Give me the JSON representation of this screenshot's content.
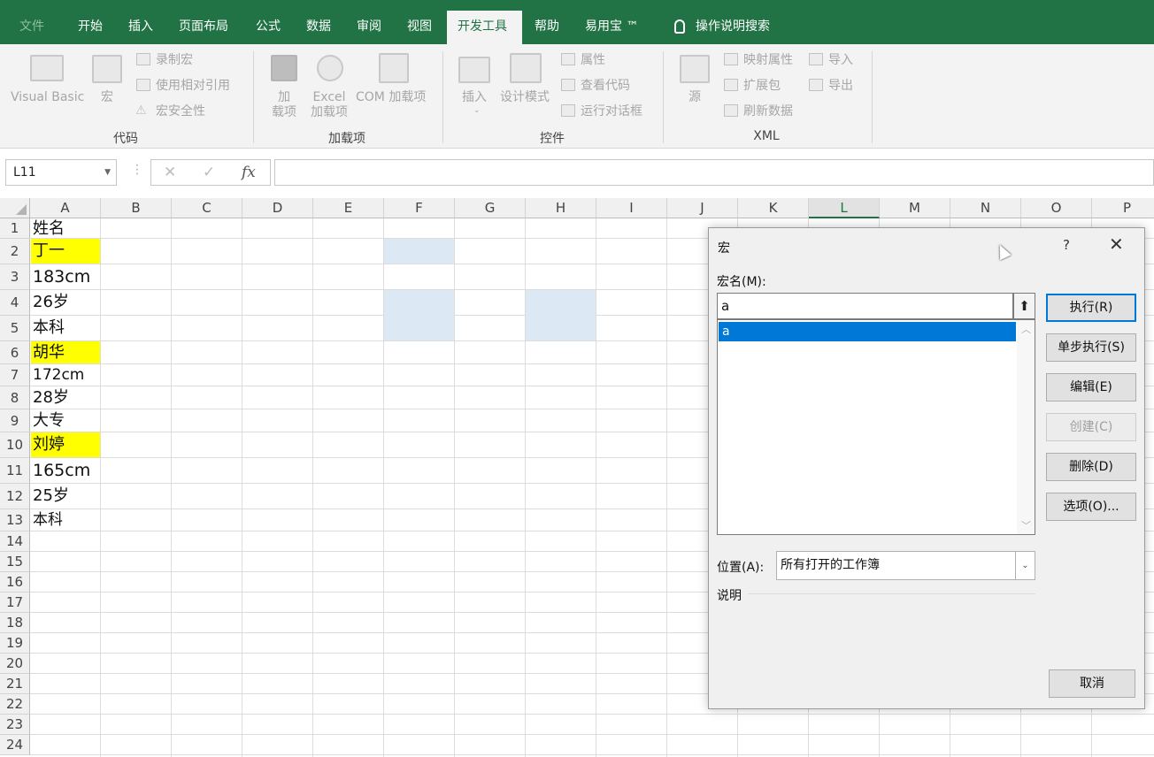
{
  "tabs": [
    {
      "label": "文件",
      "state": "dim"
    },
    {
      "label": "开始"
    },
    {
      "label": "插入"
    },
    {
      "label": "页面布局"
    },
    {
      "label": "公式"
    },
    {
      "label": "数据"
    },
    {
      "label": "审阅"
    },
    {
      "label": "视图"
    },
    {
      "label": "开发工具",
      "state": "active"
    },
    {
      "label": "帮助"
    },
    {
      "label": "易用宝 ™"
    }
  ],
  "tell_me": "操作说明搜索",
  "ribbon": {
    "code": {
      "group": "代码",
      "visual_basic": "Visual Basic",
      "macros": "宏",
      "record_macro": "录制宏",
      "relative_ref": "使用相对引用",
      "macro_security": "宏安全性"
    },
    "addins": {
      "group": "加载项",
      "addins_line1": "加",
      "addins_line2": "载项",
      "excel_line1": "Excel",
      "excel_line2": "加载项",
      "com": "COM 加载项"
    },
    "controls": {
      "group": "控件",
      "insert": "插入",
      "design_mode": "设计模式",
      "properties": "属性",
      "view_code": "查看代码",
      "run_dialog": "运行对话框"
    },
    "xml": {
      "group": "XML",
      "source": "源",
      "map_props": "映射属性",
      "expansion": "扩展包",
      "refresh": "刷新数据",
      "import": "导入",
      "export": "导出"
    }
  },
  "formula_bar": {
    "name_box": "L11",
    "fx": "fx",
    "value": ""
  },
  "columns": [
    "A",
    "B",
    "C",
    "D",
    "E",
    "F",
    "G",
    "H",
    "I",
    "J",
    "K",
    "L",
    "M",
    "N",
    "O",
    "P"
  ],
  "selected_column": "L",
  "rows": [
    "1",
    "2",
    "3",
    "4",
    "5",
    "6",
    "7",
    "8",
    "9",
    "10",
    "11",
    "12",
    "13",
    "14",
    "15",
    "16",
    "17",
    "18",
    "19",
    "20",
    "21",
    "22",
    "23",
    "24"
  ],
  "cells_a": [
    "姓名",
    "丁一",
    "183cm",
    "26岁",
    "本科",
    "胡华",
    "172cm",
    "28岁",
    "大专",
    "刘婷",
    "165cm",
    "25岁",
    "本科"
  ],
  "dialog": {
    "title": "宏",
    "help": "?",
    "macro_name_label": "宏名(M):",
    "macro_name_value": "a",
    "macro_list": [
      "a"
    ],
    "buttons": {
      "run": "执行(R)",
      "step": "单步执行(S)",
      "edit": "编辑(E)",
      "create": "创建(C)",
      "delete": "删除(D)",
      "options": "选项(O)...",
      "cancel": "取消"
    },
    "location_label": "位置(A):",
    "location_value": "所有打开的工作簿",
    "description_label": "说明"
  }
}
